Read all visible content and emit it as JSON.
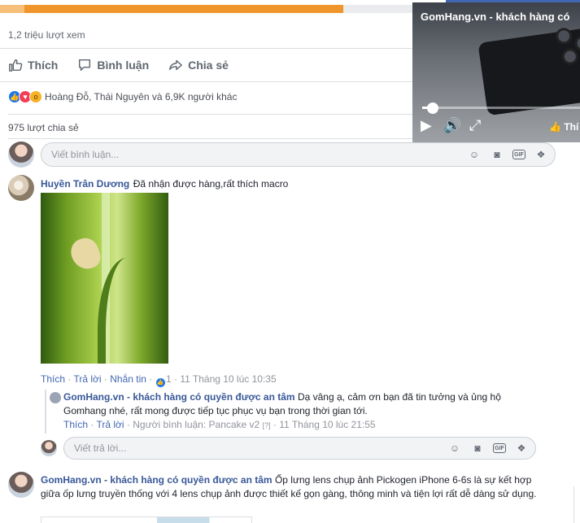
{
  "video": {
    "progress_percent": 77
  },
  "stats": {
    "views": "1,2 triệu lượt xem",
    "reactions_text": "Hoàng Đỗ, Thái Nguyên và 6,9K người khác",
    "shares": "975 lượt chia sẻ"
  },
  "actions": {
    "like": "Thích",
    "comment": "Bình luận",
    "share": "Chia sẻ"
  },
  "comment_input": {
    "placeholder": "Viết bình luận..."
  },
  "reply_input": {
    "placeholder": "Viết trả lời..."
  },
  "comments": [
    {
      "author": "Huyền Trân Dương",
      "text": "Đã nhận được hàng,rất thích macro",
      "like": "Thích",
      "reply": "Trả lời",
      "message": "Nhắn tin",
      "like_count": "1",
      "time": "11 Tháng 10 lúc 10:35"
    },
    {
      "author": "GomHang.vn - khách hàng có quyền được an tâm",
      "text": "Dạ vâng ạ, cảm ơn bạn đã tin tưởng và ủng hộ Gomhang nhé, rất mong được tiếp tục phục vụ bạn trong thời gian tới.",
      "like": "Thích",
      "reply": "Trả lời",
      "commenter": "Người bình luận: Pancake v2",
      "badge": "[?]",
      "time": "11 Tháng 10 lúc 21:55"
    },
    {
      "author": "GomHang.vn - khách hàng có quyền được an tâm",
      "text": "Ốp lưng lens chụp ảnh Pickogen iPhone 6-6s là sự kết hợp giữa ốp lưng truyền thống với 4 lens chụp ảnh được thiết kế gọn gàng, thông minh và tiện lợi rất dễ dàng sử dụng."
    }
  ],
  "mini_player": {
    "title": "GomHang.vn - khách hàng có",
    "like_label": "Thí",
    "seek_percent": 8
  },
  "colors": {
    "accent": "#f0952b",
    "link": "#385898",
    "brand": "#4267b2"
  }
}
